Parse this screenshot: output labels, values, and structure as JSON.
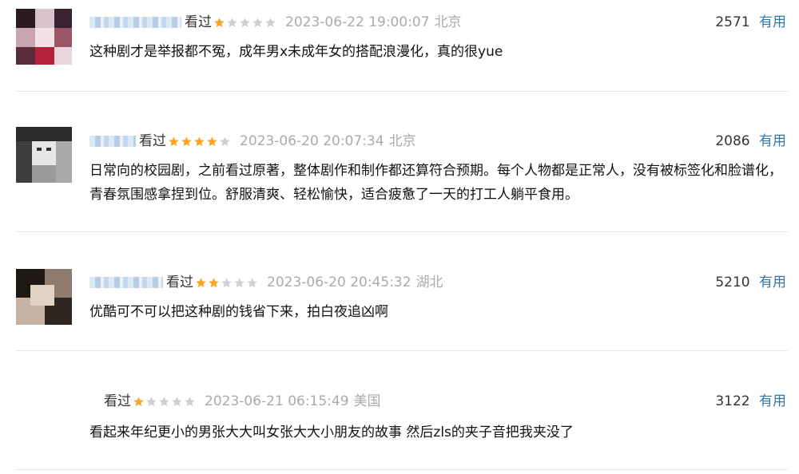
{
  "reviews": [
    {
      "watched": "看过",
      "rating": 1,
      "time": "2023-06-22 19:00:07",
      "location": "北京",
      "useful_count": "2571",
      "useful_label": "有用",
      "content": "这种剧才是举报都不冤，成年男x未成年女的搭配浪漫化，真的很yue"
    },
    {
      "watched": "看过",
      "rating": 4,
      "time": "2023-06-20 20:07:34",
      "location": "北京",
      "useful_count": "2086",
      "useful_label": "有用",
      "content": "日常向的校园剧，之前看过原著，整体剧作和制作都还算符合预期。每个人物都是正常人，没有被标签化和脸谱化，青春氛围感拿捏到位。舒服清爽、轻松愉快，适合疲惫了一天的打工人躺平食用。"
    },
    {
      "watched": "看过",
      "rating": 2,
      "time": "2023-06-20 20:45:32",
      "location": "湖北",
      "useful_count": "5210",
      "useful_label": "有用",
      "content": "优酷可不可以把这种剧的钱省下来，拍白夜追凶啊"
    },
    {
      "watched": "看过",
      "rating": 1,
      "time": "2023-06-21 06:15:49",
      "location": "美国",
      "useful_count": "3122",
      "useful_label": "有用",
      "content": "看起来年纪更小的男张大大叫女张大大小朋友的故事 然后zls的夹子音把我夹没了"
    }
  ],
  "colors": {
    "star_on": "#f6a623",
    "star_off": "#cfcfcf",
    "link": "#3377aa",
    "meta_gray": "#aaaaaa"
  },
  "icons": {
    "star": "star-icon"
  }
}
